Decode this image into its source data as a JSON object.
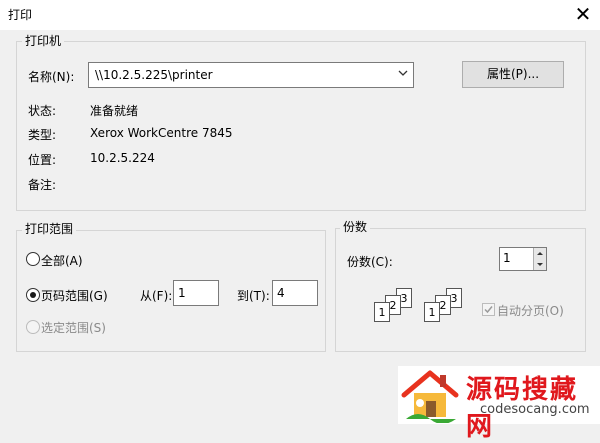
{
  "window": {
    "title": "打印"
  },
  "printer_group": {
    "label": "打印机",
    "name_label": "名称(N):",
    "name_value": "\\\\10.2.5.225\\printer",
    "properties_button": "属性(P)...",
    "status_label": "状态:",
    "status_value": "准备就绪",
    "type_label": "类型:",
    "type_value": "Xerox WorkCentre 7845",
    "location_label": "位置:",
    "location_value": "10.2.5.224",
    "comment_label": "备注:",
    "comment_value": ""
  },
  "range_group": {
    "label": "打印范围",
    "all_label": "全部(A)",
    "pages_label": "页码范围(G)",
    "from_label": "从(F):",
    "from_value": "1",
    "to_label": "到(T):",
    "to_value": "4",
    "selection_label": "选定范围(S)",
    "selected": "pages"
  },
  "copies_group": {
    "label": "份数",
    "copies_label": "份数(C):",
    "copies_value": "1",
    "collate_label": "自动分页(O)",
    "collate_checked": true,
    "collate_disabled": true,
    "collate_pages": [
      "1",
      "2",
      "3",
      "1",
      "2",
      "3"
    ]
  },
  "watermark": {
    "text": "源码搜藏网",
    "url": "codesocang.com"
  }
}
